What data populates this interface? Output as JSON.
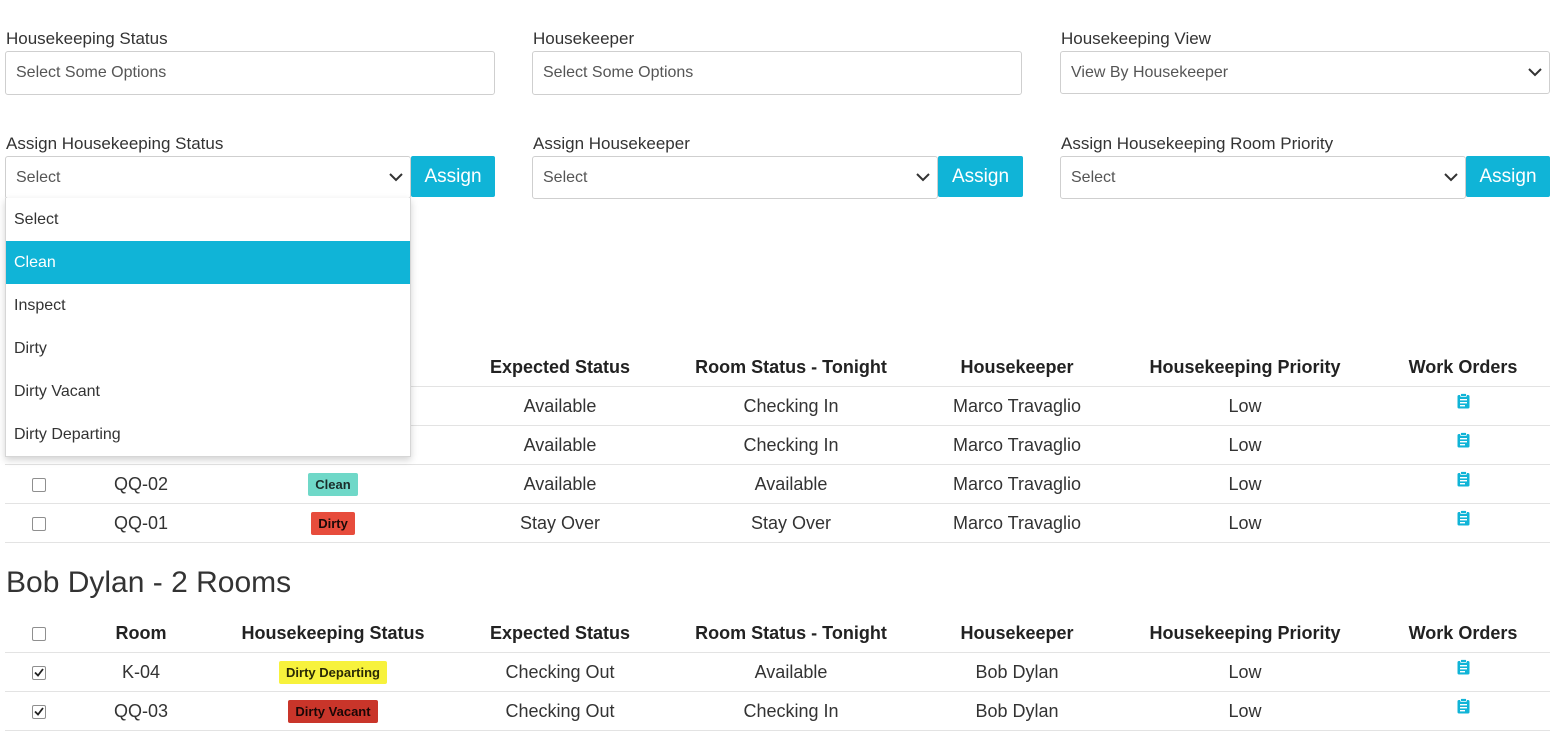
{
  "filters": {
    "status": {
      "label": "Housekeeping Status",
      "placeholder": "Select Some Options"
    },
    "housekeeper": {
      "label": "Housekeeper",
      "placeholder": "Select Some Options"
    },
    "view": {
      "label": "Housekeeping View",
      "value": "View By Housekeeper"
    }
  },
  "assign": {
    "status": {
      "label": "Assign Housekeeping Status",
      "value": "Select",
      "button": "Assign"
    },
    "housekeeper": {
      "label": "Assign Housekeeper",
      "value": "Select",
      "button": "Assign"
    },
    "priority": {
      "label": "Assign Housekeeping Room Priority",
      "value": "Select",
      "button": "Assign"
    }
  },
  "status_dropdown": {
    "options": [
      "Select",
      "Clean",
      "Inspect",
      "Dirty",
      "Dirty Vacant",
      "Dirty Departing"
    ],
    "highlighted": "Clean"
  },
  "columns": {
    "room": "Room",
    "hk_status": "Housekeeping Status",
    "hk_status_partial": "us",
    "expected": "Expected Status",
    "tonight": "Room Status - Tonight",
    "housekeeper": "Housekeeper",
    "priority": "Housekeeping Priority",
    "work_orders": "Work Orders"
  },
  "group1": {
    "rows": [
      {
        "expected": "Available",
        "tonight": "Checking In",
        "housekeeper": "Marco Travaglio",
        "priority": "Low"
      },
      {
        "expected": "Available",
        "tonight": "Checking In",
        "housekeeper": "Marco Travaglio",
        "priority": "Low"
      },
      {
        "room": "QQ-02",
        "status": "Clean",
        "expected": "Available",
        "tonight": "Available",
        "housekeeper": "Marco Travaglio",
        "priority": "Low",
        "checked": false
      },
      {
        "room": "QQ-01",
        "status": "Dirty",
        "expected": "Stay Over",
        "tonight": "Stay Over",
        "housekeeper": "Marco Travaglio",
        "priority": "Low",
        "checked": false
      }
    ]
  },
  "group2": {
    "title": "Bob Dylan - 2 Rooms",
    "rows": [
      {
        "room": "K-04",
        "status": "Dirty Departing",
        "expected": "Checking Out",
        "tonight": "Available",
        "housekeeper": "Bob Dylan",
        "priority": "Low",
        "checked": true
      },
      {
        "room": "QQ-03",
        "status": "Dirty Vacant",
        "expected": "Checking Out",
        "tonight": "Checking In",
        "housekeeper": "Bob Dylan",
        "priority": "Low",
        "checked": true
      }
    ]
  },
  "icons": {
    "chevron": "chevron-down-icon",
    "work_order": "clipboard-icon",
    "checkbox_checked": "checkmark-icon"
  },
  "colors": {
    "accent": "#10b4d7",
    "clean": "#6fd8c8",
    "dirty": "#e74c3c",
    "dirty_departing": "#f7f23c",
    "dirty_vacant": "#c9352a"
  }
}
